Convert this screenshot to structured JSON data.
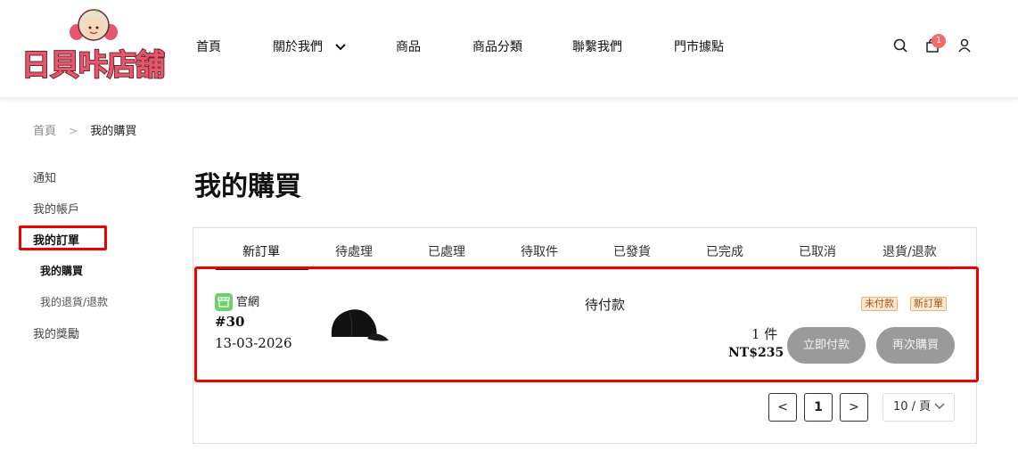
{
  "brand": {
    "logo_text": "日貝咔店舖"
  },
  "nav": {
    "items": [
      {
        "label": "首頁"
      },
      {
        "label": "關於我們"
      },
      {
        "label": "商品"
      },
      {
        "label": "商品分類"
      },
      {
        "label": "聯繫我們"
      },
      {
        "label": "門市據點"
      }
    ],
    "cart_count": "1"
  },
  "breadcrumb": {
    "home": "首頁",
    "current": "我的購買"
  },
  "sidebar": {
    "items": [
      {
        "label": "通知"
      },
      {
        "label": "我的帳戶"
      },
      {
        "label": "我的訂單"
      }
    ],
    "subitems": [
      {
        "label": "我的購買"
      },
      {
        "label": "我的退貨/退款"
      }
    ],
    "rewards": "我的獎勵"
  },
  "page": {
    "title": "我的購買"
  },
  "tabs": [
    {
      "label": "新訂單"
    },
    {
      "label": "待處理"
    },
    {
      "label": "已處理"
    },
    {
      "label": "待取件"
    },
    {
      "label": "已發貨"
    },
    {
      "label": "已完成"
    },
    {
      "label": "已取消"
    },
    {
      "label": "退貨/退款"
    }
  ],
  "order": {
    "channel": "官網",
    "number": "#30",
    "date": "13-03-2026",
    "status": "待付款",
    "badges": [
      "未付款",
      "新訂單"
    ],
    "quantity": "1 件",
    "total": "NT$235",
    "pay_button": "立即付款",
    "rebuy_button": "再次購買"
  },
  "pagination": {
    "prev": "<",
    "current_page": "1",
    "next": ">",
    "page_size": "10 / 頁"
  },
  "colors": {
    "accent_red": "#e00000",
    "badge_bg": "#fde8cf",
    "pill_gray": "#9a9a9a",
    "cart_badge": "#f36a6a"
  }
}
